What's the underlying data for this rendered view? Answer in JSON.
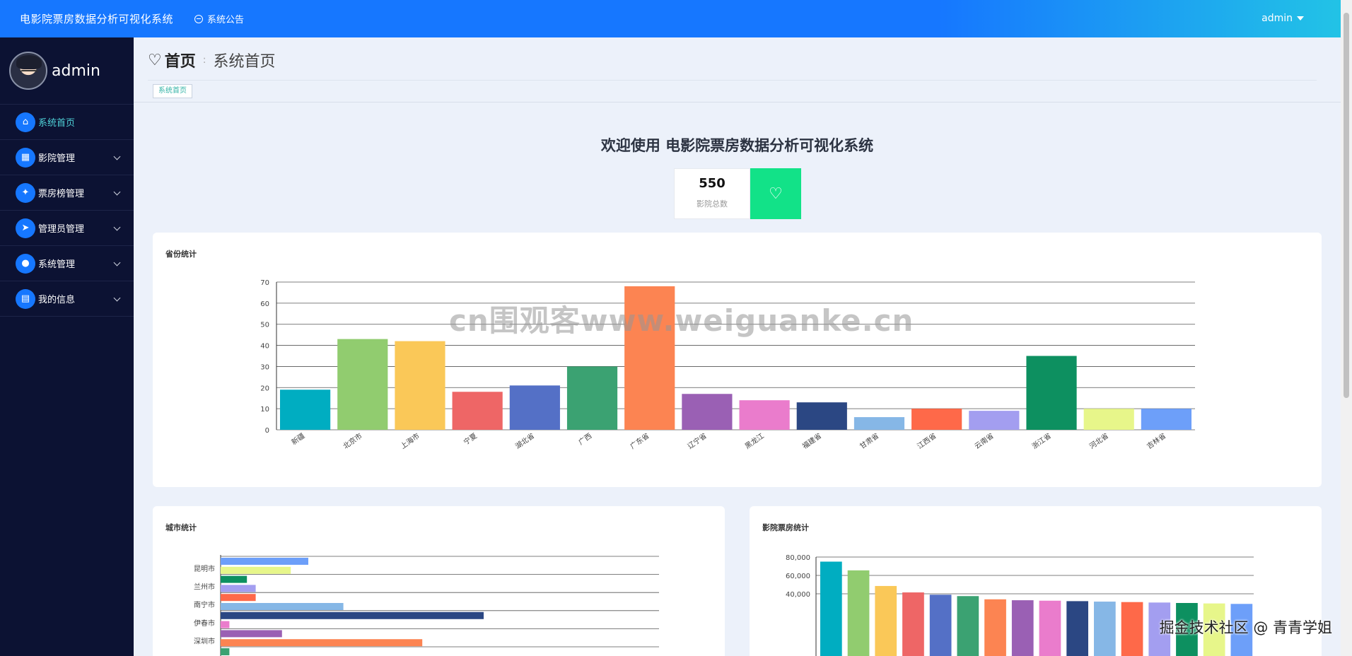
{
  "topbar": {
    "title": "电影院票房数据分析可视化系统",
    "notice": "系统公告",
    "user": "admin"
  },
  "sidebar": {
    "username": "admin",
    "items": [
      {
        "label": "系统首页",
        "icon": "home-icon",
        "active": true
      },
      {
        "label": "影院管理",
        "icon": "grid-icon"
      },
      {
        "label": "票房榜管理",
        "icon": "ticket-icon"
      },
      {
        "label": "管理员管理",
        "icon": "send-icon"
      },
      {
        "label": "系统管理",
        "icon": "user-icon"
      },
      {
        "label": "我的信息",
        "icon": "card-icon"
      }
    ]
  },
  "header": {
    "home": "首页",
    "current": "系统首页",
    "tab": "系统首页"
  },
  "welcome": "欢迎使用 电影院票房数据分析可视化系统",
  "stat": {
    "value": "550",
    "label": "影院总数"
  },
  "watermark": "cn围观客www.weiguanke.cn",
  "footer_watermark": "掘金技术社区 @ 青青学姐",
  "chart_data": [
    {
      "type": "bar",
      "title": "省份统计",
      "categories": [
        "新疆",
        "北京市",
        "上海市",
        "宁夏",
        "湖北省",
        "广西",
        "广东省",
        "辽宁省",
        "黑龙江",
        "福建省",
        "甘肃省",
        "江西省",
        "云南省",
        "浙江省",
        "河北省",
        "吉林省"
      ],
      "values": [
        19,
        43,
        42,
        18,
        21,
        30,
        68,
        17,
        14,
        13,
        6,
        10,
        9,
        35,
        10,
        10
      ],
      "colors": [
        "#00adc1",
        "#91cc6f",
        "#fac858",
        "#ee6666",
        "#5470c6",
        "#3ba272",
        "#fc8452",
        "#9a60b4",
        "#ea7ccc",
        "#2b4783",
        "#86b7e6",
        "#fe6949",
        "#a39ef0",
        "#0d9060",
        "#e7f68a",
        "#6d9ff9"
      ],
      "ylim": [
        0,
        70
      ],
      "yticks": [
        0,
        10,
        20,
        30,
        40,
        50,
        60,
        70
      ],
      "grid": true
    },
    {
      "type": "bar",
      "orientation": "horizontal",
      "title": "城市统计",
      "categories": [
        "昆明市",
        "兰州市",
        "南宁市",
        "伊春市",
        "深圳市"
      ],
      "bars": [
        {
          "value": 20,
          "color": "#6d9ff9"
        },
        {
          "value": 16,
          "color": "#e7f68a"
        },
        {
          "value": 6,
          "color": "#0d9060"
        },
        {
          "value": 8,
          "color": "#a39ef0"
        },
        {
          "value": 8,
          "color": "#fe6949"
        },
        {
          "value": 28,
          "color": "#86b7e6"
        },
        {
          "value": 60,
          "color": "#2b4783"
        },
        {
          "value": 2,
          "color": "#ea7ccc"
        },
        {
          "value": 14,
          "color": "#9a60b4"
        },
        {
          "value": 46,
          "color": "#fc8452"
        },
        {
          "value": 2,
          "color": "#3ba272"
        }
      ],
      "xlim": [
        0,
        100
      ],
      "grid": true
    },
    {
      "type": "bar",
      "title": "影院票房统计",
      "values": [
        75000,
        65500,
        48500,
        41500,
        39000,
        37500,
        34000,
        33000,
        32500,
        32000,
        31500,
        31000,
        30500,
        30000,
        29500,
        29000
      ],
      "colors": [
        "#00adc1",
        "#91cc6f",
        "#fac858",
        "#ee6666",
        "#5470c6",
        "#3ba272",
        "#fc8452",
        "#9a60b4",
        "#ea7ccc",
        "#2b4783",
        "#86b7e6",
        "#fe6949",
        "#a39ef0",
        "#0d9060",
        "#e7f68a",
        "#6d9ff9"
      ],
      "ylim": [
        0,
        80000
      ],
      "yticks": [
        "40,000",
        "60,000",
        "80,000"
      ],
      "yticks_values": [
        40000,
        60000,
        80000
      ],
      "grid": true
    }
  ]
}
